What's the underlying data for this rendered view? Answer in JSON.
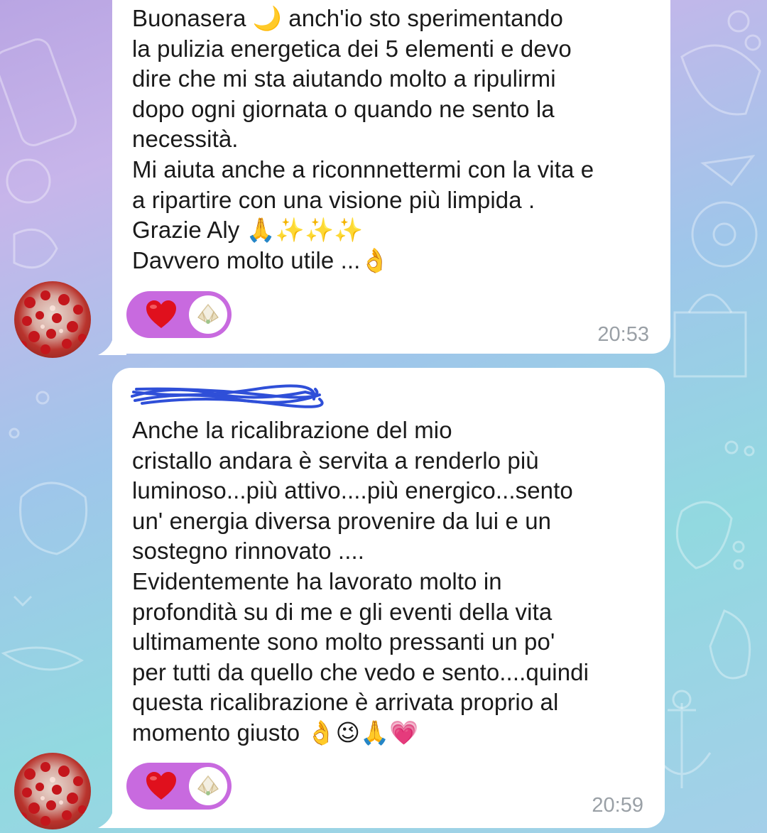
{
  "messages": [
    {
      "text": "Buonasera 🌙 anch'io sto sperimentando\nla pulizia energetica dei 5 elementi e devo\ndire che mi sta aiutando molto a ripulirmi\ndopo ogni giornata o quando ne sento la\nnecessità.\nMi aiuta anche a riconnnettermi con la vita e\na ripartire con una visione più limpida .\nGrazie Aly 🙏✨✨✨\nDavvero molto utile ...👌",
      "reaction_emoji": "heart",
      "time": "20:53"
    },
    {
      "sender_redacted": true,
      "text": "Anche la ricalibrazione del mio\ncristallo andara è servita a renderlo più\nluminoso...più attivo....più energico...sento\nun' energia diversa provenire da lui e un\nsostegno rinnovato ....\nEvidentemente ha lavorato molto in\nprofondità su di me e gli eventi della vita\nultimamente sono molto pressanti un po'\nper tutti da quello che vedo e sento....quindi\nquesta ricalibrazione è arrivata proprio al\nmomento giusto 👌😉🙏💗",
      "reaction_emoji": "heart",
      "time": "20:59"
    }
  ],
  "colors": {
    "reaction_bg": "#c86adf",
    "time": "#9aa0a6",
    "bubble": "#ffffff"
  }
}
